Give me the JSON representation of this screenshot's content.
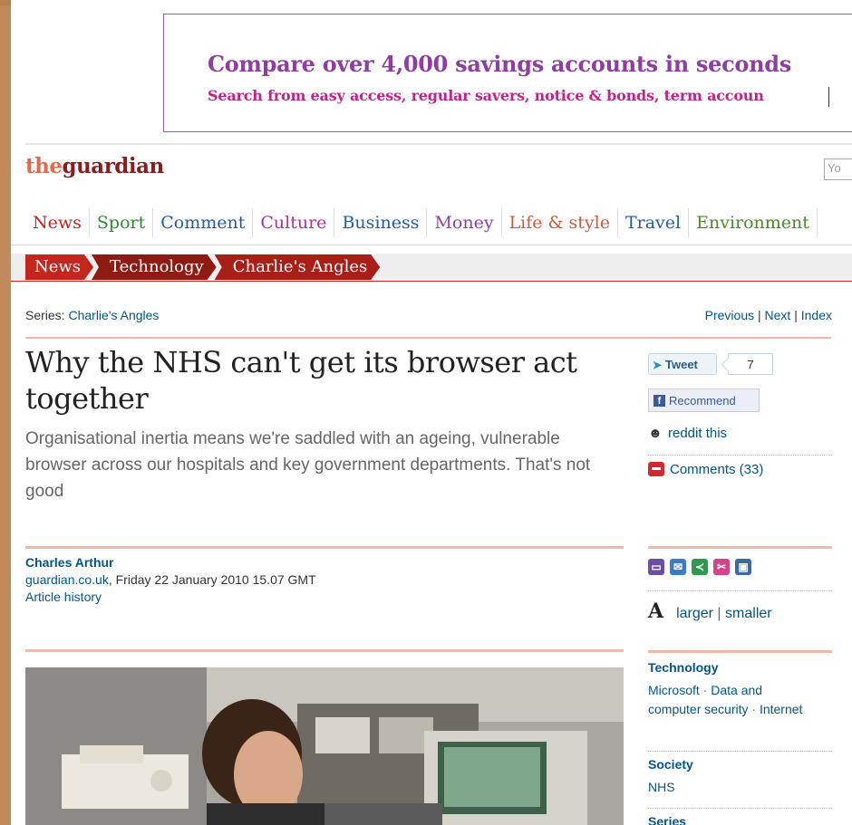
{
  "ad": {
    "title": "Compare over 4,000 savings accounts in seconds",
    "subtitle": "Search from easy access, regular savers, notice & bonds, term accoun"
  },
  "header": {
    "logo_the": "the",
    "logo_guardian": "guardian",
    "search_placeholder": "Yo"
  },
  "nav": {
    "items": [
      {
        "label": "News",
        "color": "#c4261d"
      },
      {
        "label": "Sport",
        "color": "#2e8b2e"
      },
      {
        "label": "Comment",
        "color": "#1f5fa0"
      },
      {
        "label": "Culture",
        "color": "#b42fa0"
      },
      {
        "label": "Business",
        "color": "#1f5fa0"
      },
      {
        "label": "Money",
        "color": "#8d3fa6"
      },
      {
        "label": "Life & style",
        "color": "#cc5a3a"
      },
      {
        "label": "Travel",
        "color": "#1f5fa0"
      },
      {
        "label": "Environment",
        "color": "#4a8a2a"
      }
    ]
  },
  "breadcrumb": [
    "News",
    "Technology",
    "Charlie's Angles"
  ],
  "series": {
    "prefix": "Series: ",
    "name": "Charlie's Angles",
    "previous": "Previous",
    "next": "Next",
    "index": "Index",
    "sep": " | "
  },
  "article": {
    "headline": "Why the NHS can't get its browser act together",
    "standfirst": "Organisational inertia means we're saddled with an ageing, vulnerable browser across our hospitals and key government departments. That's not good",
    "author": "Charles Arthur",
    "source": "guardian.co.uk",
    "date": ", Friday 22 January 2010 15.07 GMT",
    "history": "Article history"
  },
  "social": {
    "tweet_label": "Tweet",
    "tweet_count": "7",
    "recommend_label": "Recommend",
    "reddit_label": "reddit this",
    "comments_label": "Comments (33)"
  },
  "text_size": {
    "icon": "A",
    "larger": "larger",
    "sep": " | ",
    "smaller": "smaller"
  },
  "tags": {
    "technology_heading": "Technology",
    "technology_microsoft": "Microsoft",
    "technology_security": "Data and computer security",
    "technology_internet": "Internet",
    "society_heading": "Society",
    "society_nhs": "NHS",
    "series_heading": "Series"
  }
}
